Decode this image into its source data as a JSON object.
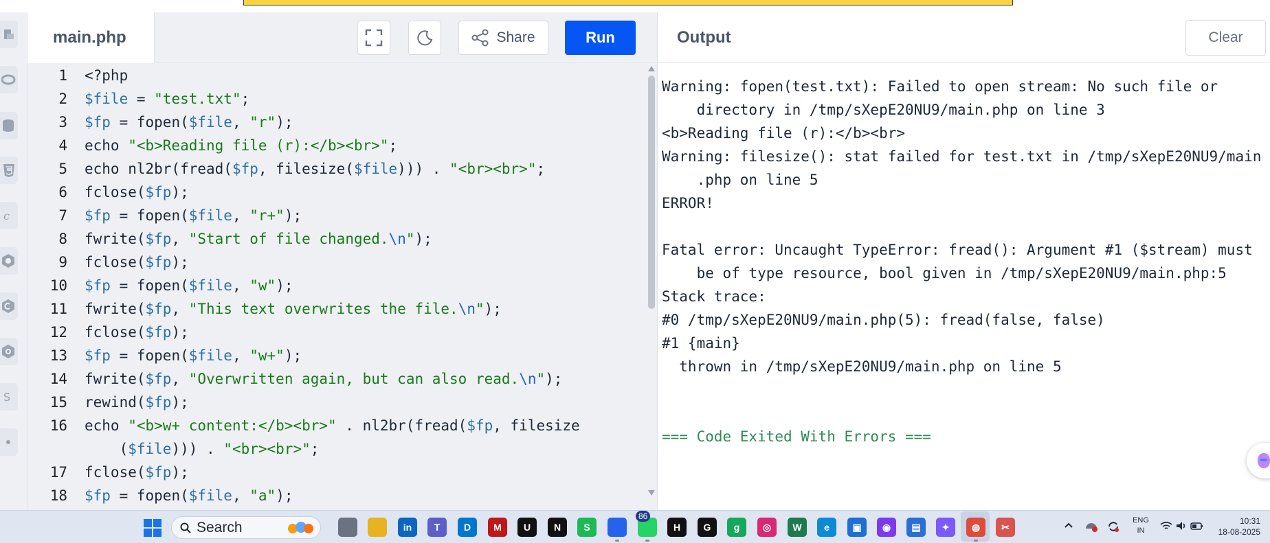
{
  "editor": {
    "file_name": "main.php",
    "share_label": "Share",
    "run_label": "Run",
    "lines": [
      {
        "n": "1",
        "tokens": [
          {
            "t": "<?php",
            "c": "plain"
          }
        ]
      },
      {
        "n": "2",
        "tokens": [
          {
            "t": "$file",
            "c": "var"
          },
          {
            "t": " = ",
            "c": "plain"
          },
          {
            "t": "\"test.txt\"",
            "c": "str"
          },
          {
            "t": ";",
            "c": "plain"
          }
        ]
      },
      {
        "n": "3",
        "tokens": [
          {
            "t": "$fp",
            "c": "var"
          },
          {
            "t": " = fopen(",
            "c": "plain"
          },
          {
            "t": "$file",
            "c": "var"
          },
          {
            "t": ", ",
            "c": "plain"
          },
          {
            "t": "\"r\"",
            "c": "str"
          },
          {
            "t": ");",
            "c": "plain"
          }
        ]
      },
      {
        "n": "4",
        "tokens": [
          {
            "t": "echo ",
            "c": "plain"
          },
          {
            "t": "\"<b>Reading file (r):</b><br>\"",
            "c": "str"
          },
          {
            "t": ";",
            "c": "plain"
          }
        ]
      },
      {
        "n": "5",
        "tokens": [
          {
            "t": "echo nl2br(fread(",
            "c": "plain"
          },
          {
            "t": "$fp",
            "c": "var"
          },
          {
            "t": ", filesize(",
            "c": "plain"
          },
          {
            "t": "$file",
            "c": "var"
          },
          {
            "t": "))) . ",
            "c": "plain"
          },
          {
            "t": "\"<br><br>\"",
            "c": "str"
          },
          {
            "t": ";",
            "c": "plain"
          }
        ]
      },
      {
        "n": "6",
        "tokens": [
          {
            "t": "fclose(",
            "c": "plain"
          },
          {
            "t": "$fp",
            "c": "var"
          },
          {
            "t": ");",
            "c": "plain"
          }
        ]
      },
      {
        "n": "7",
        "tokens": [
          {
            "t": "$fp",
            "c": "var"
          },
          {
            "t": " = fopen(",
            "c": "plain"
          },
          {
            "t": "$file",
            "c": "var"
          },
          {
            "t": ", ",
            "c": "plain"
          },
          {
            "t": "\"r+\"",
            "c": "str"
          },
          {
            "t": ");",
            "c": "plain"
          }
        ]
      },
      {
        "n": "8",
        "tokens": [
          {
            "t": "fwrite(",
            "c": "plain"
          },
          {
            "t": "$fp",
            "c": "var"
          },
          {
            "t": ", ",
            "c": "plain"
          },
          {
            "t": "\"Start of file changed.",
            "c": "str"
          },
          {
            "t": "\\n",
            "c": "esc"
          },
          {
            "t": "\"",
            "c": "str"
          },
          {
            "t": ");",
            "c": "plain"
          }
        ]
      },
      {
        "n": "9",
        "tokens": [
          {
            "t": "fclose(",
            "c": "plain"
          },
          {
            "t": "$fp",
            "c": "var"
          },
          {
            "t": ");",
            "c": "plain"
          }
        ]
      },
      {
        "n": "10",
        "tokens": [
          {
            "t": "$fp",
            "c": "var"
          },
          {
            "t": " = fopen(",
            "c": "plain"
          },
          {
            "t": "$file",
            "c": "var"
          },
          {
            "t": ", ",
            "c": "plain"
          },
          {
            "t": "\"w\"",
            "c": "str"
          },
          {
            "t": ");",
            "c": "plain"
          }
        ]
      },
      {
        "n": "11",
        "tokens": [
          {
            "t": "fwrite(",
            "c": "plain"
          },
          {
            "t": "$fp",
            "c": "var"
          },
          {
            "t": ", ",
            "c": "plain"
          },
          {
            "t": "\"This text overwrites the file.",
            "c": "str"
          },
          {
            "t": "\\n",
            "c": "esc"
          },
          {
            "t": "\"",
            "c": "str"
          },
          {
            "t": ");",
            "c": "plain"
          }
        ]
      },
      {
        "n": "12",
        "tokens": [
          {
            "t": "fclose(",
            "c": "plain"
          },
          {
            "t": "$fp",
            "c": "var"
          },
          {
            "t": ");",
            "c": "plain"
          }
        ]
      },
      {
        "n": "13",
        "tokens": [
          {
            "t": "$fp",
            "c": "var"
          },
          {
            "t": " = fopen(",
            "c": "plain"
          },
          {
            "t": "$file",
            "c": "var"
          },
          {
            "t": ", ",
            "c": "plain"
          },
          {
            "t": "\"w+\"",
            "c": "str"
          },
          {
            "t": ");",
            "c": "plain"
          }
        ]
      },
      {
        "n": "14",
        "tokens": [
          {
            "t": "fwrite(",
            "c": "plain"
          },
          {
            "t": "$fp",
            "c": "var"
          },
          {
            "t": ", ",
            "c": "plain"
          },
          {
            "t": "\"Overwritten again, but can also read.",
            "c": "str"
          },
          {
            "t": "\\n",
            "c": "esc"
          },
          {
            "t": "\"",
            "c": "str"
          },
          {
            "t": ");",
            "c": "plain"
          }
        ]
      },
      {
        "n": "15",
        "tokens": [
          {
            "t": "rewind(",
            "c": "plain"
          },
          {
            "t": "$fp",
            "c": "var"
          },
          {
            "t": ");",
            "c": "plain"
          }
        ]
      },
      {
        "n": "16",
        "tokens": [
          {
            "t": "echo ",
            "c": "plain"
          },
          {
            "t": "\"<b>w+ content:</b><br>\"",
            "c": "str"
          },
          {
            "t": " . nl2br(fread(",
            "c": "plain"
          },
          {
            "t": "$fp",
            "c": "var"
          },
          {
            "t": ", filesize",
            "c": "plain"
          }
        ]
      },
      {
        "n": "",
        "tokens": [
          {
            "t": "    (",
            "c": "plain"
          },
          {
            "t": "$file",
            "c": "var"
          },
          {
            "t": "))) . ",
            "c": "plain"
          },
          {
            "t": "\"<br><br>\"",
            "c": "str"
          },
          {
            "t": ";",
            "c": "plain"
          }
        ]
      },
      {
        "n": "17",
        "tokens": [
          {
            "t": "fclose(",
            "c": "plain"
          },
          {
            "t": "$fp",
            "c": "var"
          },
          {
            "t": ");",
            "c": "plain"
          }
        ]
      },
      {
        "n": "18",
        "tokens": [
          {
            "t": "$fp",
            "c": "var"
          },
          {
            "t": " = fopen(",
            "c": "plain"
          },
          {
            "t": "$file",
            "c": "var"
          },
          {
            "t": ", ",
            "c": "plain"
          },
          {
            "t": "\"a\"",
            "c": "str"
          },
          {
            "t": ");",
            "c": "plain"
          }
        ]
      }
    ]
  },
  "output": {
    "title": "Output",
    "clear_label": "Clear",
    "lines": [
      "Warning: fopen(test.txt): Failed to open stream: No such file or",
      "    directory in /tmp/sXepE20NU9/main.php on line 3",
      "<b>Reading file (r):</b><br>",
      "Warning: filesize(): stat failed for test.txt in /tmp/sXepE20NU9/main",
      "    .php on line 5",
      "ERROR!",
      "",
      "Fatal error: Uncaught TypeError: fread(): Argument #1 ($stream) must",
      "    be of type resource, bool given in /tmp/sXepE20NU9/main.php:5",
      "Stack trace:",
      "#0 /tmp/sXepE20NU9/main.php(5): fread(false, false)",
      "#1 {main}",
      "  thrown in /tmp/sXepE20NU9/main.php on line 5",
      "",
      "",
      "=== Code Exited With Errors ==="
    ]
  },
  "taskbar": {
    "search_label": "Search",
    "badge_count": "86",
    "lang_line1": "ENG",
    "lang_line2": "IN",
    "time": "10:31",
    "date": "18-08-2025",
    "apps": [
      {
        "name": "task-view",
        "color": "#6b7280",
        "glyph": ""
      },
      {
        "name": "file-explorer",
        "color": "#e8b321",
        "glyph": ""
      },
      {
        "name": "linkedin",
        "color": "#0a66c2",
        "glyph": "in"
      },
      {
        "name": "teams",
        "color": "#5b5fc7",
        "glyph": "T"
      },
      {
        "name": "dell",
        "color": "#0076ce",
        "glyph": "D"
      },
      {
        "name": "mcafee",
        "color": "#c01818",
        "glyph": "M"
      },
      {
        "name": "uber",
        "color": "#111111",
        "glyph": "U"
      },
      {
        "name": "netflix",
        "color": "#111111",
        "glyph": "N"
      },
      {
        "name": "spotify",
        "color": "#1db954",
        "glyph": "S"
      },
      {
        "name": "store",
        "color": "#2563eb",
        "glyph": ""
      },
      {
        "name": "whatsapp",
        "color": "#25d366",
        "glyph": ""
      },
      {
        "name": "hotstar",
        "color": "#111111",
        "glyph": "H"
      },
      {
        "name": "chatgpt",
        "color": "#111111",
        "glyph": "G"
      },
      {
        "name": "grammarly",
        "color": "#15a85c",
        "glyph": "g"
      },
      {
        "name": "instagram",
        "color": "#d62976",
        "glyph": "◎"
      },
      {
        "name": "wps",
        "color": "#1f7a4d",
        "glyph": "W"
      },
      {
        "name": "edge",
        "color": "#0c8ad6",
        "glyph": "e"
      },
      {
        "name": "video-editor",
        "color": "#1d6fd6",
        "glyph": "▣"
      },
      {
        "name": "record",
        "color": "#7c3aed",
        "glyph": "◉"
      },
      {
        "name": "notepad",
        "color": "#2b6fd6",
        "glyph": "▤"
      },
      {
        "name": "copilot",
        "color": "#7a5af8",
        "glyph": "✦"
      },
      {
        "name": "chrome",
        "color": "#dd4b39",
        "glyph": "◍"
      },
      {
        "name": "snipping-tool",
        "color": "#d9534f",
        "glyph": "✂"
      }
    ]
  }
}
